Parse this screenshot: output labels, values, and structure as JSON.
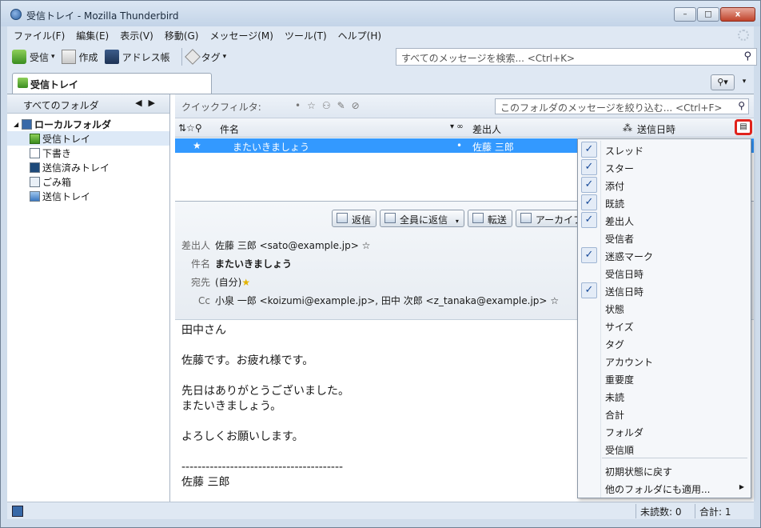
{
  "window": {
    "title": "受信トレイ - Mozilla Thunderbird",
    "minimize_label": "–",
    "maximize_label": "□",
    "close_label": "x"
  },
  "menubar": [
    "ファイル(F)",
    "編集(E)",
    "表示(V)",
    "移動(G)",
    "メッセージ(M)",
    "ツール(T)",
    "ヘルプ(H)"
  ],
  "toolbar": {
    "get_label": "受信",
    "write_label": "作成",
    "addressbook_label": "アドレス帳",
    "tag_label": "タグ",
    "search_placeholder": "すべてのメッセージを検索... <Ctrl+K>"
  },
  "tab": {
    "label": "受信トレイ"
  },
  "folderpane": {
    "header": "すべてのフォルダ",
    "root": "ローカルフォルダ",
    "folders": [
      "受信トレイ",
      "下書き",
      "送信済みトレイ",
      "ごみ箱",
      "送信トレイ"
    ]
  },
  "quickfilter": {
    "label": "クイックフィルタ:",
    "search_placeholder": "このフォルダのメッセージを絞り込む... <Ctrl+F>"
  },
  "threadpane": {
    "columns": {
      "subject": "件名",
      "from": "差出人",
      "date": "送信日時"
    },
    "rows": [
      {
        "subject": "またいきましょう",
        "from": "佐藤 三郎"
      }
    ]
  },
  "message": {
    "buttons": {
      "reply": "返信",
      "reply_all": "全員に返信",
      "forward": "転送",
      "archive": "アーカイブ"
    },
    "labels": {
      "from": "差出人",
      "subject": "件名",
      "to": "宛先",
      "cc": "Cc"
    },
    "from": "佐藤 三郎 <sato@example.jp>",
    "subject": "またいきましょう",
    "to": "(自分)",
    "cc": "小泉 一郎 <koizumi@example.jp>, 田中 次郎 <z_tanaka@example.jp>",
    "body": [
      "田中さん",
      "",
      "佐藤です。お疲れ様です。",
      "",
      "先日はありがとうございました。",
      "またいきましょう。",
      "",
      "よろしくお願いします。",
      "",
      "----------------------------------------",
      "佐藤 三郎"
    ]
  },
  "column_menu": {
    "items": [
      {
        "label": "スレッド",
        "checked": true
      },
      {
        "label": "スター",
        "checked": true
      },
      {
        "label": "添付",
        "checked": true
      },
      {
        "label": "既読",
        "checked": true
      },
      {
        "label": "差出人",
        "checked": true
      },
      {
        "label": "受信者",
        "checked": false
      },
      {
        "label": "迷惑マーク",
        "checked": true
      },
      {
        "label": "受信日時",
        "checked": false
      },
      {
        "label": "送信日時",
        "checked": true
      },
      {
        "label": "状態",
        "checked": false
      },
      {
        "label": "サイズ",
        "checked": false
      },
      {
        "label": "タグ",
        "checked": false
      },
      {
        "label": "アカウント",
        "checked": false
      },
      {
        "label": "重要度",
        "checked": false
      },
      {
        "label": "未読",
        "checked": false
      },
      {
        "label": "合計",
        "checked": false
      },
      {
        "label": "フォルダ",
        "checked": false
      },
      {
        "label": "受信順",
        "checked": false
      }
    ],
    "restore_label": "初期状態に戻す",
    "apply_label": "他のフォルダにも適用..."
  },
  "statusbar": {
    "unread": "未読数: 0",
    "total": "合計: 1"
  },
  "colors": {
    "selection": "#3399ff",
    "highlight_box": "#e0221c"
  }
}
